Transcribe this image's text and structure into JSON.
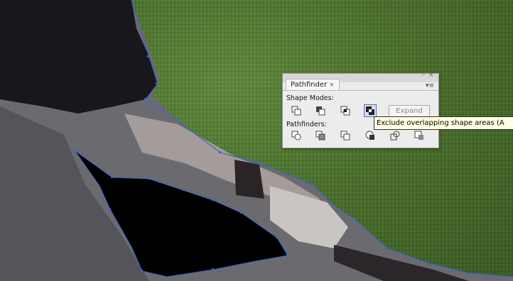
{
  "panel": {
    "tab_title": "Pathfinder",
    "tab_close_glyph": "×",
    "minimize_glyph": "–",
    "window_close_glyph": "×",
    "menu_glyph": "▾≡",
    "shape_modes_label": "Shape Modes:",
    "pathfinders_label": "Pathfinders:",
    "expand_label": "Expand",
    "shape_mode_buttons": [
      "unite-icon",
      "minus-front-icon",
      "intersect-icon",
      "exclude-icon"
    ],
    "pathfinder_buttons": [
      "divide-icon",
      "trim-icon",
      "merge-icon",
      "crop-icon",
      "outline-icon",
      "minus-back-icon"
    ],
    "active_button": "exclude-icon"
  },
  "tooltip": {
    "text": "Exclude overlapping shape areas (A"
  },
  "colors": {
    "path_stroke": "#3f64c8",
    "grass": "#4a722b",
    "selection_fill": "#000000"
  }
}
